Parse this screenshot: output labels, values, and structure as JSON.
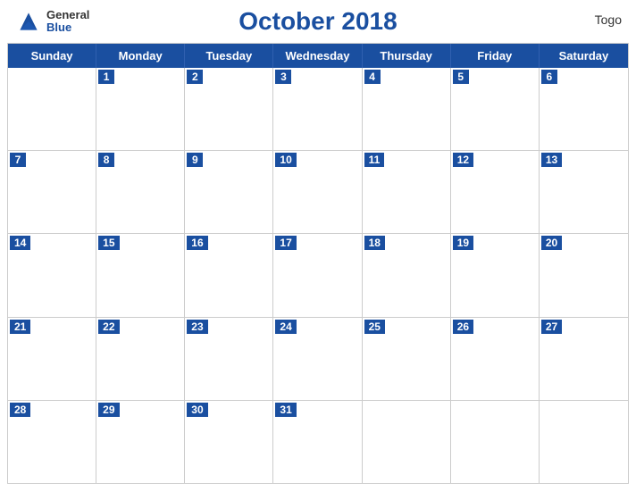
{
  "header": {
    "logo_general": "General",
    "logo_blue": "Blue",
    "month_title": "October 2018",
    "country": "Togo"
  },
  "days_of_week": [
    "Sunday",
    "Monday",
    "Tuesday",
    "Wednesday",
    "Thursday",
    "Friday",
    "Saturday"
  ],
  "weeks": [
    [
      null,
      1,
      2,
      3,
      4,
      5,
      6
    ],
    [
      7,
      8,
      9,
      10,
      11,
      12,
      13
    ],
    [
      14,
      15,
      16,
      17,
      18,
      19,
      20
    ],
    [
      21,
      22,
      23,
      24,
      25,
      26,
      27
    ],
    [
      28,
      29,
      30,
      31,
      null,
      null,
      null
    ]
  ]
}
